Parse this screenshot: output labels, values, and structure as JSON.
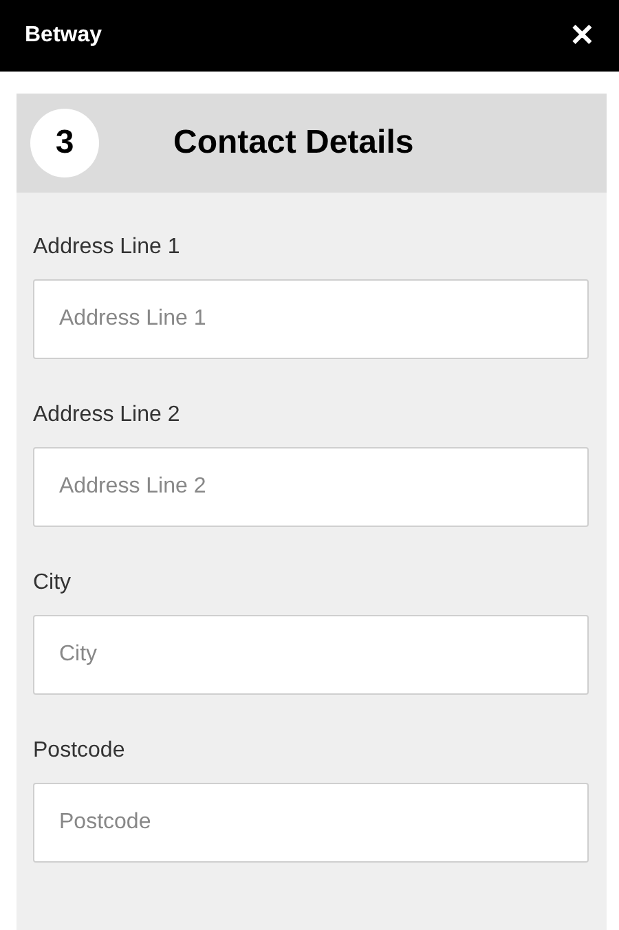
{
  "top_bar": {
    "title": "Betway",
    "close": "✕"
  },
  "section": {
    "step": "3",
    "title": "Contact Details"
  },
  "fields": [
    {
      "label": "Address Line 1",
      "placeholder": "Address Line 1"
    },
    {
      "label": "Address Line 2",
      "placeholder": "Address Line 2"
    },
    {
      "label": "City",
      "placeholder": "City"
    },
    {
      "label": "Postcode",
      "placeholder": "Postcode"
    }
  ]
}
